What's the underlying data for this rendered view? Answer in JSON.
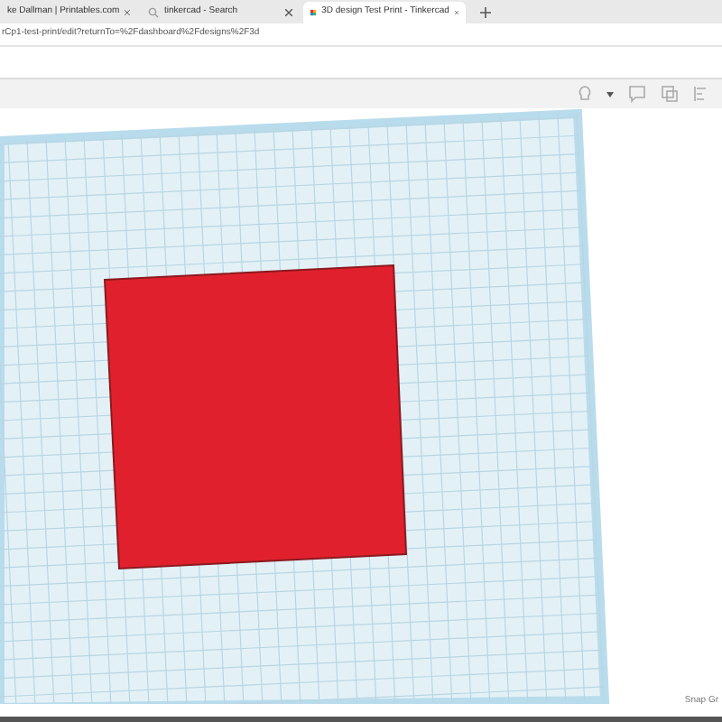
{
  "tabs": [
    {
      "title": "ke Dallman | Printables.com",
      "selected": false,
      "kind": "page"
    },
    {
      "title": "tinkercad - Search",
      "selected": false,
      "kind": "search"
    },
    {
      "title": "3D design Test Print - Tinkercad",
      "selected": true,
      "kind": "app"
    }
  ],
  "address_bar": {
    "url": "rCp1-test-print/edit?returnTo=%2Fdashboard%2Fdesigns%2F3d"
  },
  "snap_grid": {
    "label": "Snap Gr"
  }
}
